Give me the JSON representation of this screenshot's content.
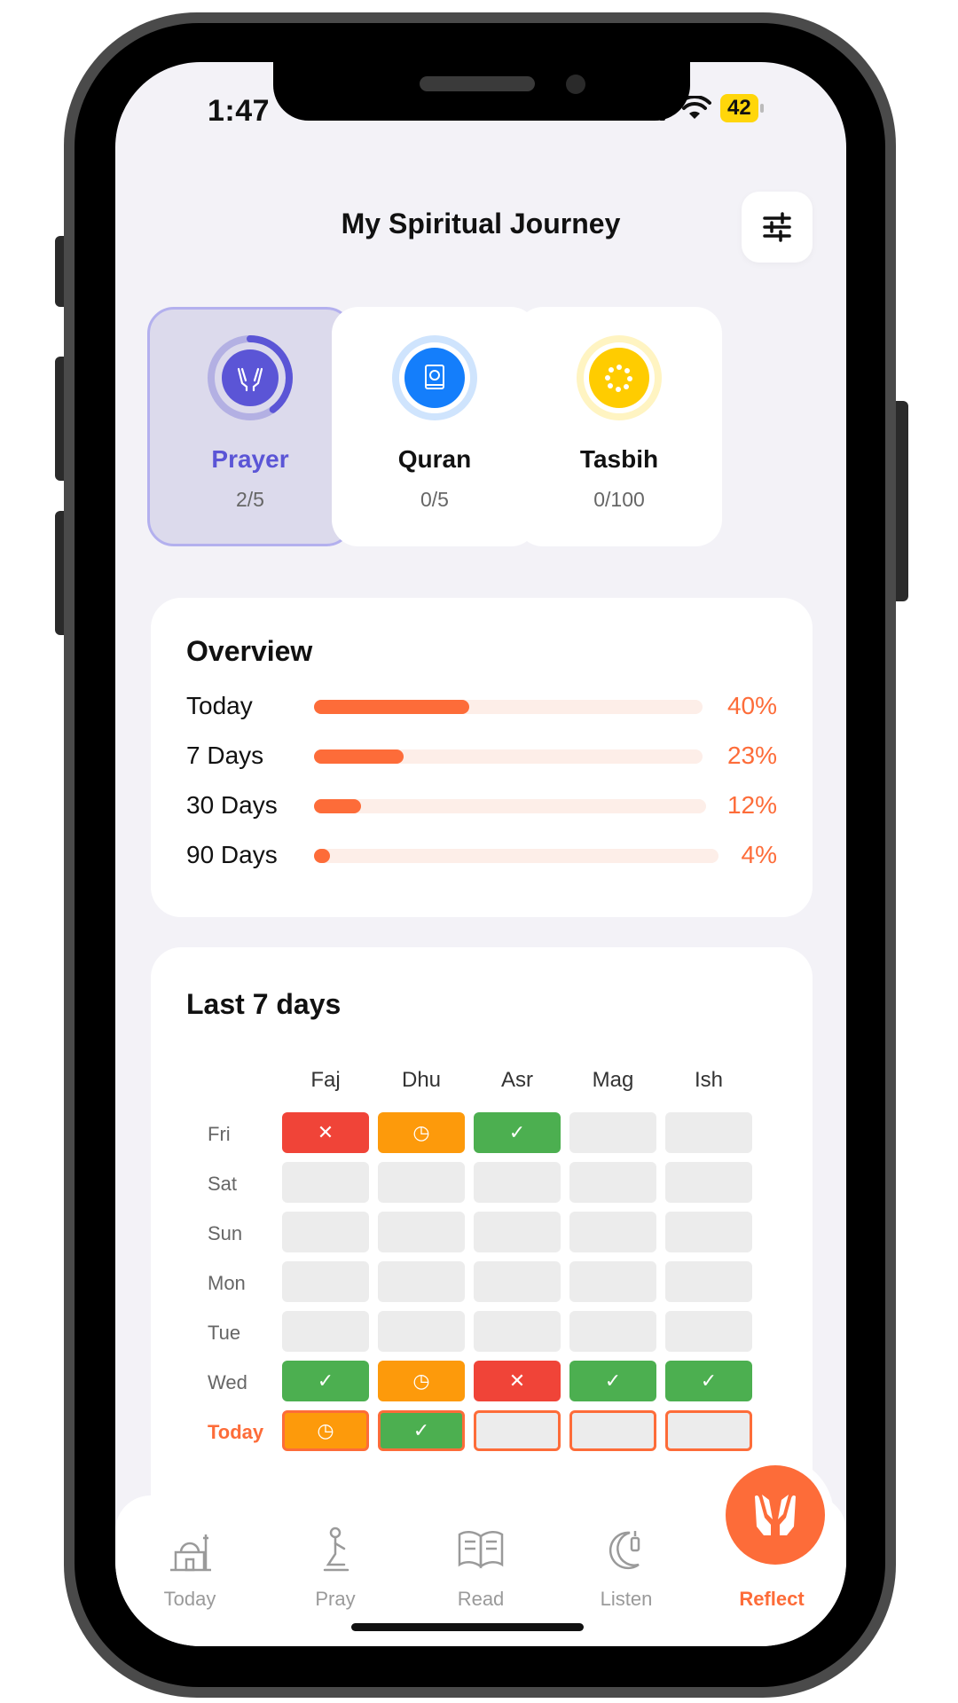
{
  "status_bar": {
    "time": "1:47",
    "battery": "42"
  },
  "header": {
    "title": "My Spiritual Journey"
  },
  "categories": [
    {
      "name": "Prayer",
      "count": "2/5",
      "progress": 0.4,
      "color": "#5b55d6"
    },
    {
      "name": "Quran",
      "count": "0/5",
      "progress": 0,
      "color": "#147efb"
    },
    {
      "name": "Tasbih",
      "count": "0/100",
      "progress": 0,
      "color": "#ffcc00"
    }
  ],
  "overview": {
    "title": "Overview",
    "rows": [
      {
        "label": "Today",
        "value": "40%",
        "progress": 0.4
      },
      {
        "label": "7 Days",
        "value": "23%",
        "progress": 0.23
      },
      {
        "label": "30 Days",
        "value": "12%",
        "progress": 0.12
      },
      {
        "label": "90 Days",
        "value": "4%",
        "progress": 0.04
      }
    ]
  },
  "week": {
    "title": "Last 7 days",
    "columns": [
      "Faj",
      "Dhu",
      "Asr",
      "Mag",
      "Ish"
    ],
    "rows": [
      {
        "day": "Fri",
        "cells": [
          "missed",
          "late",
          "done",
          "none",
          "none"
        ]
      },
      {
        "day": "Sat",
        "cells": [
          "none",
          "none",
          "none",
          "none",
          "none"
        ]
      },
      {
        "day": "Sun",
        "cells": [
          "none",
          "none",
          "none",
          "none",
          "none"
        ]
      },
      {
        "day": "Mon",
        "cells": [
          "none",
          "none",
          "none",
          "none",
          "none"
        ]
      },
      {
        "day": "Tue",
        "cells": [
          "none",
          "none",
          "none",
          "none",
          "none"
        ]
      },
      {
        "day": "Wed",
        "cells": [
          "done",
          "late",
          "missed",
          "done",
          "done"
        ]
      },
      {
        "day": "Today",
        "cells": [
          "late",
          "done",
          "none",
          "none",
          "none"
        ]
      }
    ]
  },
  "tabs": [
    {
      "label": "Today",
      "icon": "mosque-icon"
    },
    {
      "label": "Pray",
      "icon": "praying-person-icon"
    },
    {
      "label": "Read",
      "icon": "open-book-icon"
    },
    {
      "label": "Listen",
      "icon": "crescent-lantern-icon"
    },
    {
      "label": "Reflect",
      "icon": "praying-hands-icon",
      "active": true
    }
  ],
  "colors": {
    "accent": "#fd6c39",
    "prayer": "#5b55d6",
    "missed": "#f04438",
    "late": "#fd9a0b",
    "done": "#4caf50"
  }
}
